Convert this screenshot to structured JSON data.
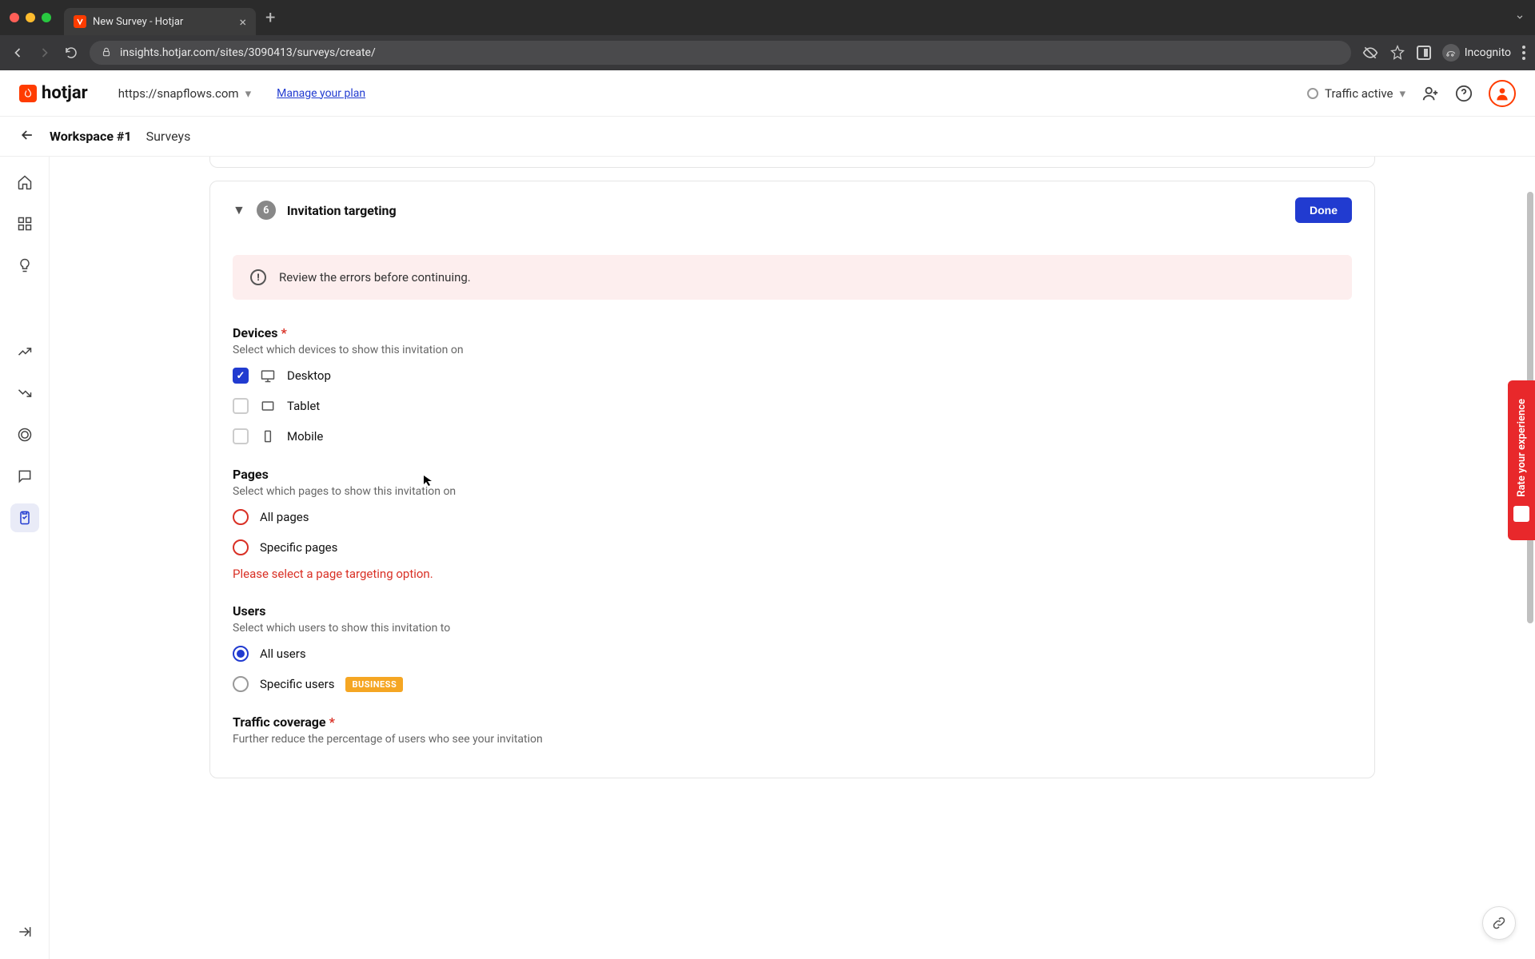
{
  "browser": {
    "tab_title": "New Survey - Hotjar",
    "url": "insights.hotjar.com/sites/3090413/surveys/create/",
    "profile_label": "Incognito"
  },
  "header": {
    "logo_text": "hotjar",
    "site_url": "https://snapflows.com",
    "manage_plan": "Manage your plan",
    "traffic_status": "Traffic active"
  },
  "crumbs": {
    "workspace": "Workspace #1",
    "section": "Surveys"
  },
  "panel": {
    "step_number": "6",
    "title": "Invitation targeting",
    "done_label": "Done"
  },
  "alert": {
    "message": "Review the errors before continuing."
  },
  "devices": {
    "title": "Devices",
    "subtitle": "Select which devices to show this invitation on",
    "options": {
      "desktop": "Desktop",
      "tablet": "Tablet",
      "mobile": "Mobile"
    }
  },
  "pages": {
    "title": "Pages",
    "subtitle": "Select which pages to show this invitation on",
    "options": {
      "all": "All pages",
      "specific": "Specific pages"
    },
    "error": "Please select a page targeting option."
  },
  "users": {
    "title": "Users",
    "subtitle": "Select which users to show this invitation to",
    "options": {
      "all": "All users",
      "specific": "Specific users"
    },
    "business_badge": "BUSINESS"
  },
  "traffic": {
    "title": "Traffic coverage",
    "subtitle": "Further reduce the percentage of users who see your invitation"
  },
  "feedback": {
    "label": "Rate your experience"
  }
}
